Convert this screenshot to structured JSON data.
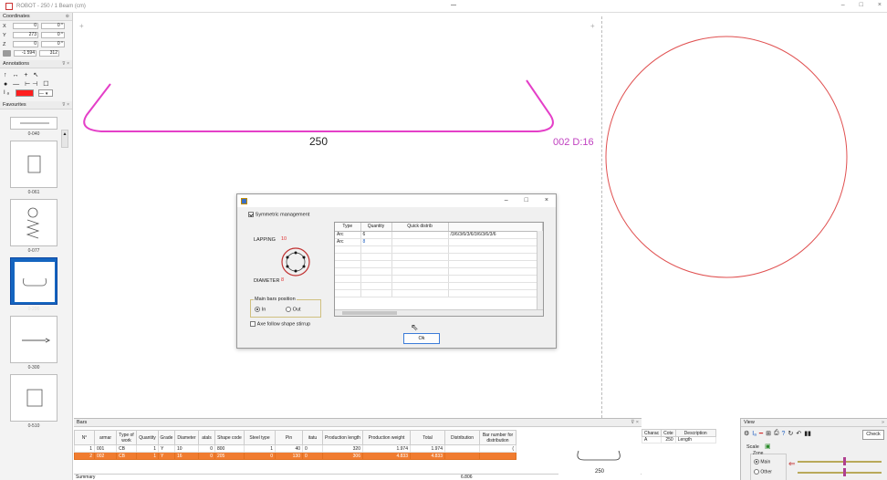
{
  "window": {
    "title": "ROBOT - 250 / 1 Beam (cm)",
    "minimize": "–",
    "maximize": "□",
    "close": "×"
  },
  "coordinates": {
    "header": "Coordinates",
    "x": {
      "label": "X",
      "value": "0",
      "angle": "0 °"
    },
    "y": {
      "label": "Y",
      "value": "273",
      "angle": "0 °"
    },
    "z": {
      "label": "Z",
      "value": "0",
      "angle": "0 °"
    },
    "extra": {
      "v1": "-1 594",
      "v2": "312"
    }
  },
  "annotations": {
    "header": "Annotations",
    "row1": "↑ ↔ + ↖",
    "row2": "● — ⊢⊣ ☐",
    "font_label": "Iₐ",
    "color": "#ff1e1e"
  },
  "favourites": {
    "header": "Favourites",
    "items": [
      {
        "label": "0-040"
      },
      {
        "label": "0-061"
      },
      {
        "label": "0-077"
      },
      {
        "label": "0-200"
      },
      {
        "label": "0-300"
      },
      {
        "label": "0-510"
      }
    ]
  },
  "canvas": {
    "dimension_label": "250",
    "bar_label": "002 D:16",
    "shape_color": "#e43fc8",
    "circle_color": "#e05050"
  },
  "dialog": {
    "symmetric_label": "Symmetric management",
    "lapping_label": "LAPPING",
    "lapping_value": "10",
    "diameter_label": "DIAMETER",
    "diameter_value": "8",
    "main_bars_label": "Main bars position",
    "in_label": "In",
    "out_label": "Out",
    "axe_follow_label": "Axe follow shape stirrup",
    "ok_label": "Ok",
    "grid_headers": [
      "Type",
      "Quantity",
      "Quick distrib",
      ""
    ],
    "grid_rows": [
      {
        "type": "Arc",
        "quantity": "6",
        "quick": "",
        "dist": "/3/6/3/6/3/6/3/6/3/6/3/6"
      },
      {
        "type": "Arc",
        "quantity": "8",
        "quick": "",
        "dist": ""
      }
    ]
  },
  "bars": {
    "header": "Bars",
    "columns": [
      "N°",
      "armar",
      "Type of work",
      "Quantity",
      "Grade",
      "Diameter",
      "atals",
      "Shape code",
      "Steel type",
      "Pin",
      "itatu",
      "Production length",
      "Production weight",
      "Total",
      "Distribution",
      "Bar number for distribution"
    ],
    "rows": [
      {
        "n": "1",
        "armar": "001",
        "type": "CB",
        "qty": "1",
        "grade": "Y",
        "dia": "10",
        "atals": "0",
        "shape": "800",
        "steel": "1",
        "pin": "40",
        "itatu": "0",
        "plen": "320",
        "pweight": "1.974",
        "total": "1.974",
        "dist": "",
        "barnum": "("
      },
      {
        "n": "2",
        "armar": "002",
        "type": "CB",
        "qty": "1",
        "grade": "Y",
        "dia": "16",
        "atals": "0",
        "shape": "205",
        "steel": "0",
        "pin": "130",
        "itatu": "0",
        "plen": "306",
        "pweight": "4.833",
        "total": "4.833",
        "dist": "",
        "barnum": ""
      }
    ],
    "footer_label": "Summary",
    "footer_total": "6.806"
  },
  "shape_preview": {
    "label": "250"
  },
  "charac": {
    "headers": [
      "Charac",
      "Cote",
      "Description"
    ],
    "rows": [
      {
        "charac": "A",
        "cote": "250",
        "desc": "Length"
      }
    ]
  },
  "view": {
    "header": "View",
    "check_label": "Check",
    "scale_label": "Scale",
    "zone_label": "Zone",
    "main_label": "Main",
    "other_label": "Other"
  }
}
